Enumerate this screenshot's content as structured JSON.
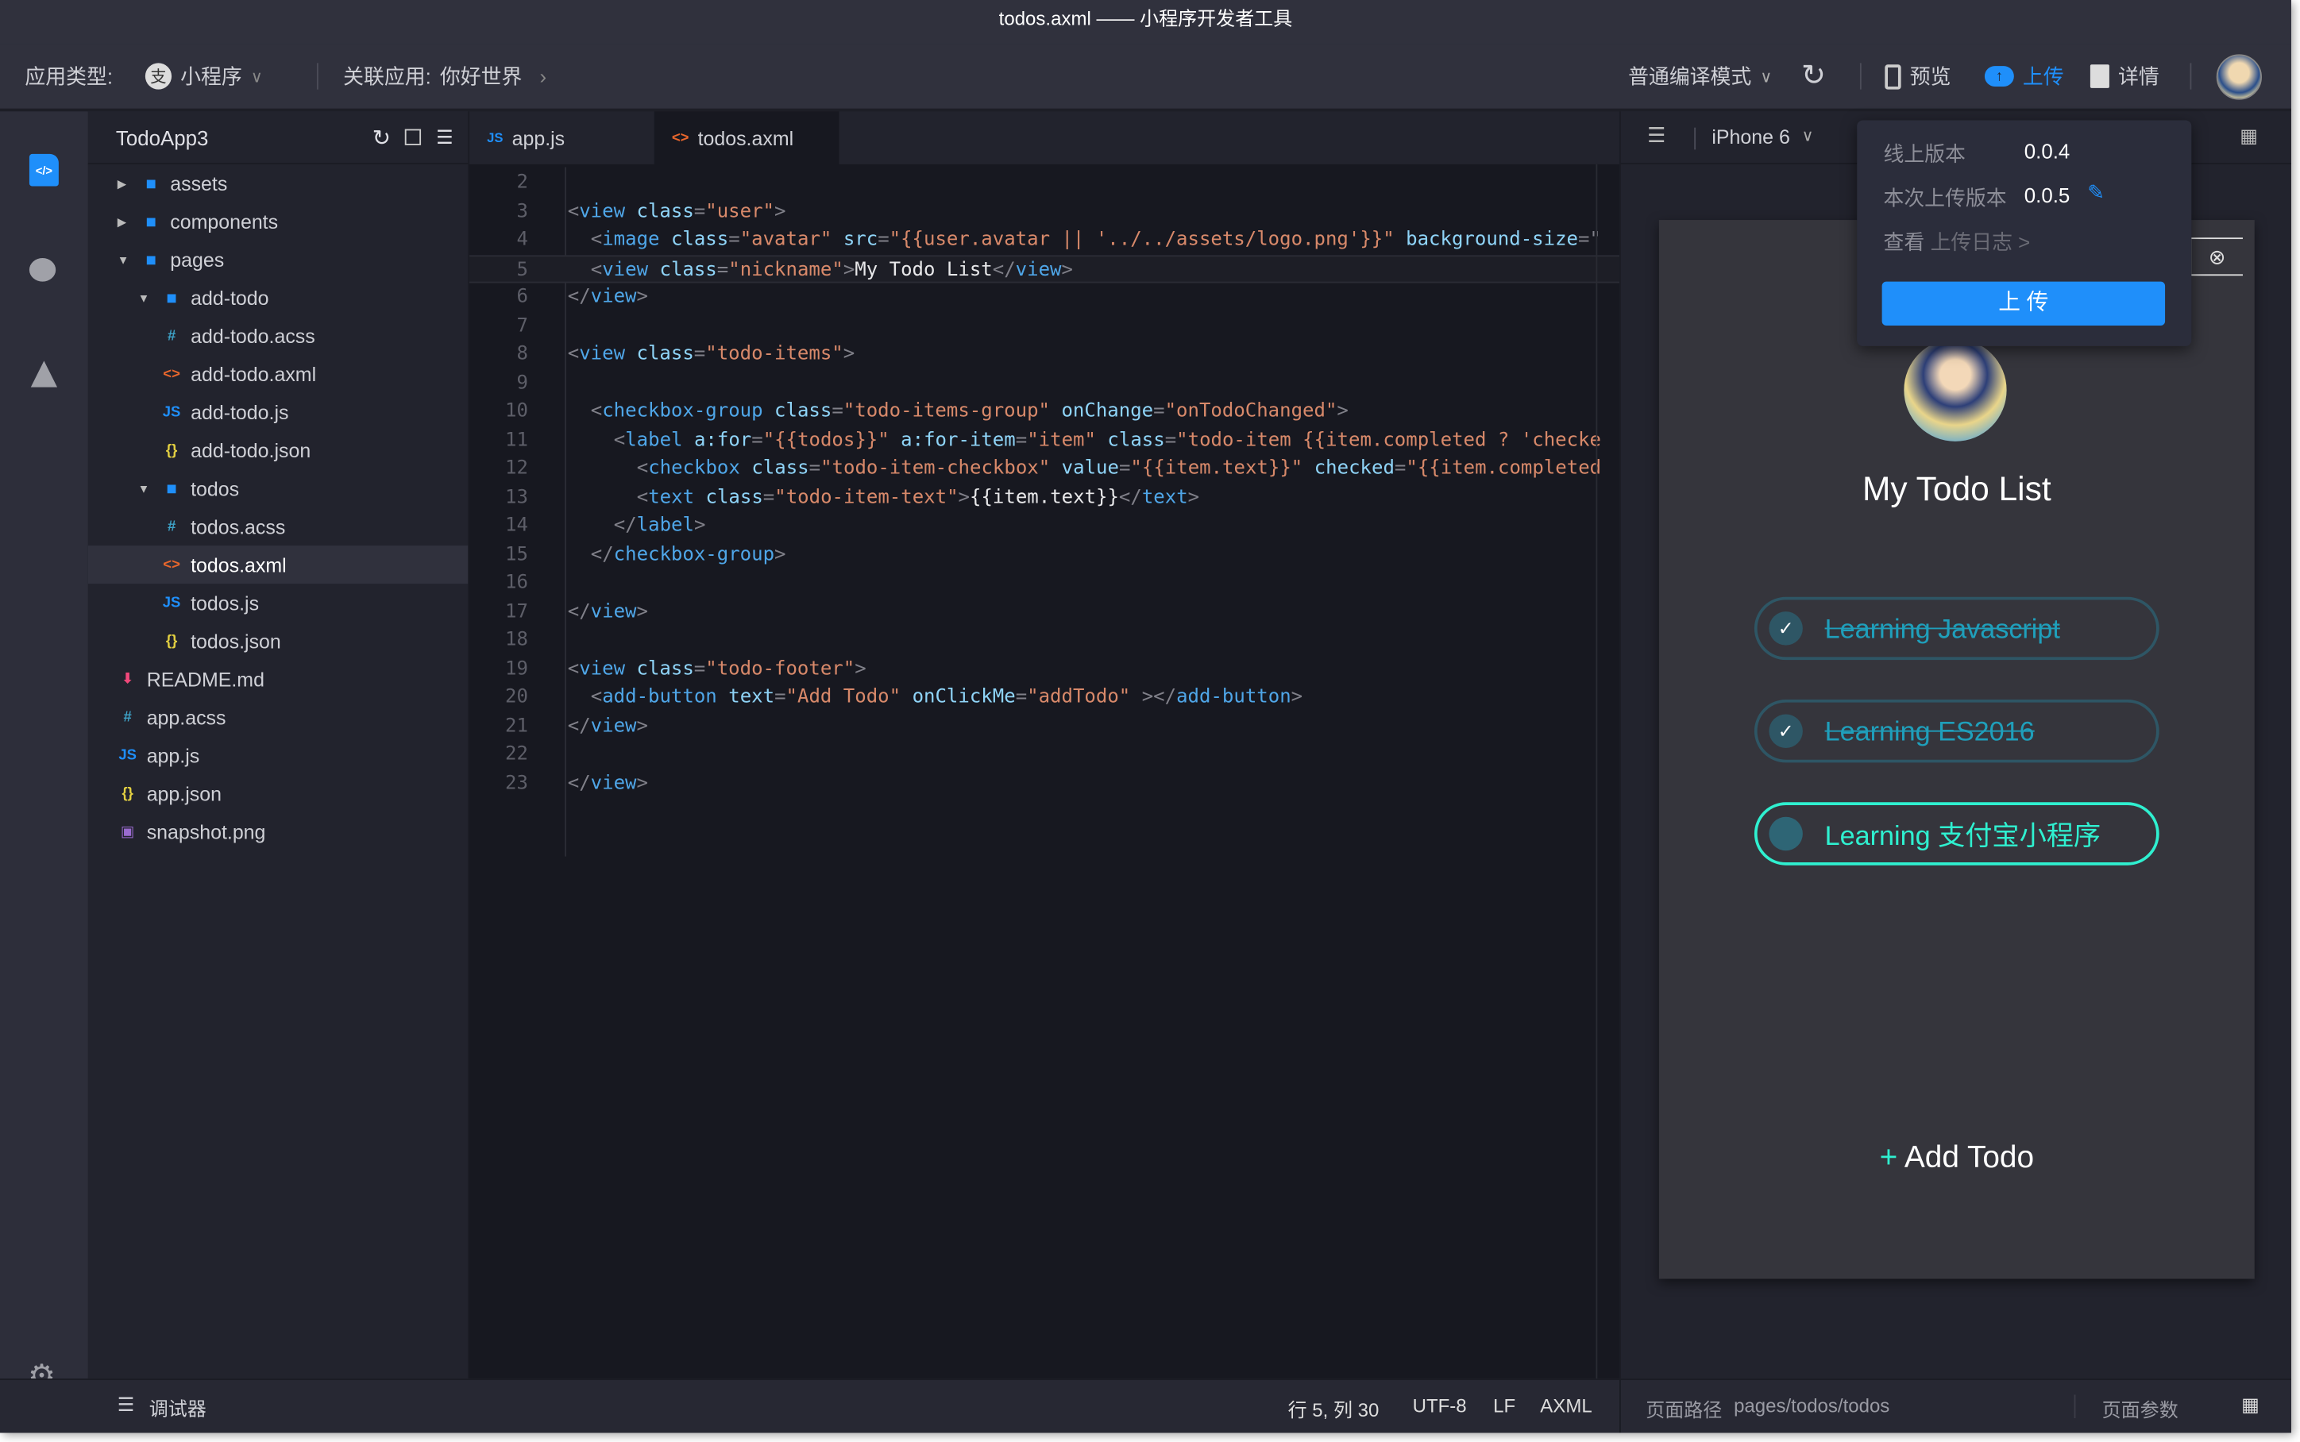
{
  "window": {
    "title": "todos.axml —— 小程序开发者工具"
  },
  "toolbar": {
    "app_type_label": "应用类型:",
    "app_type_value": "小程序",
    "linked_app_label": "关联应用:",
    "linked_app_value": "你好世界",
    "compile_mode": "普通编译模式",
    "preview": "预览",
    "upload": "上传",
    "details": "详情"
  },
  "explorer": {
    "project": "TodoApp3",
    "items": [
      {
        "label": "assets",
        "type": "folder",
        "depth": 0,
        "expanded": false
      },
      {
        "label": "components",
        "type": "folder",
        "depth": 0,
        "expanded": false
      },
      {
        "label": "pages",
        "type": "folder",
        "depth": 0,
        "expanded": true
      },
      {
        "label": "add-todo",
        "type": "folder",
        "depth": 1,
        "expanded": true
      },
      {
        "label": "add-todo.acss",
        "type": "acss",
        "depth": 2
      },
      {
        "label": "add-todo.axml",
        "type": "axml",
        "depth": 2
      },
      {
        "label": "add-todo.js",
        "type": "js",
        "depth": 2
      },
      {
        "label": "add-todo.json",
        "type": "json",
        "depth": 2
      },
      {
        "label": "todos",
        "type": "folder",
        "depth": 1,
        "expanded": true
      },
      {
        "label": "todos.acss",
        "type": "acss",
        "depth": 2
      },
      {
        "label": "todos.axml",
        "type": "axml",
        "depth": 2,
        "selected": true
      },
      {
        "label": "todos.js",
        "type": "js",
        "depth": 2
      },
      {
        "label": "todos.json",
        "type": "json",
        "depth": 2
      },
      {
        "label": "README.md",
        "type": "md",
        "depth": 0
      },
      {
        "label": "app.acss",
        "type": "acss",
        "depth": 0
      },
      {
        "label": "app.js",
        "type": "js",
        "depth": 0
      },
      {
        "label": "app.json",
        "type": "json",
        "depth": 0
      },
      {
        "label": "snapshot.png",
        "type": "png",
        "depth": 0
      }
    ]
  },
  "tabs": [
    {
      "label": "app.js",
      "type": "js"
    },
    {
      "label": "todos.axml",
      "type": "axml",
      "active": true
    }
  ],
  "code": {
    "current_line": 5,
    "lines": [
      {
        "n": "2",
        "indent": 0,
        "tokens": []
      },
      {
        "n": "3",
        "indent": 1,
        "tokens": [
          [
            "p",
            "<"
          ],
          [
            "tag",
            "view"
          ],
          [
            "t",
            " "
          ],
          [
            "attr",
            "class"
          ],
          [
            "p",
            "="
          ],
          [
            "str",
            "\"user\""
          ],
          [
            "p",
            ">"
          ]
        ]
      },
      {
        "n": "4",
        "indent": 2,
        "tokens": [
          [
            "p",
            "<"
          ],
          [
            "tag",
            "image"
          ],
          [
            "t",
            " "
          ],
          [
            "attr",
            "class"
          ],
          [
            "p",
            "="
          ],
          [
            "str",
            "\"avatar\""
          ],
          [
            "t",
            " "
          ],
          [
            "attr",
            "src"
          ],
          [
            "p",
            "="
          ],
          [
            "str",
            "\"{{user.avatar || '../../assets/logo.png'}}\""
          ],
          [
            "t",
            " "
          ],
          [
            "attr",
            "background-size"
          ],
          [
            "p",
            "=\""
          ]
        ]
      },
      {
        "n": "5",
        "indent": 2,
        "tokens": [
          [
            "p",
            "<"
          ],
          [
            "tag",
            "view"
          ],
          [
            "t",
            " "
          ],
          [
            "attr",
            "class"
          ],
          [
            "p",
            "="
          ],
          [
            "str",
            "\"nickname\""
          ],
          [
            "p",
            ">"
          ],
          [
            "txt",
            "My Todo List"
          ],
          [
            "p",
            "</"
          ],
          [
            "tag",
            "view"
          ],
          [
            "p",
            ">"
          ]
        ]
      },
      {
        "n": "6",
        "indent": 1,
        "tokens": [
          [
            "p",
            "</"
          ],
          [
            "tag",
            "view"
          ],
          [
            "p",
            ">"
          ]
        ]
      },
      {
        "n": "7",
        "indent": 0,
        "tokens": []
      },
      {
        "n": "8",
        "indent": 1,
        "tokens": [
          [
            "p",
            "<"
          ],
          [
            "tag",
            "view"
          ],
          [
            "t",
            " "
          ],
          [
            "attr",
            "class"
          ],
          [
            "p",
            "="
          ],
          [
            "str",
            "\"todo-items\""
          ],
          [
            "p",
            ">"
          ]
        ]
      },
      {
        "n": "9",
        "indent": 0,
        "tokens": []
      },
      {
        "n": "10",
        "indent": 2,
        "tokens": [
          [
            "p",
            "<"
          ],
          [
            "tag",
            "checkbox-group"
          ],
          [
            "t",
            " "
          ],
          [
            "attr",
            "class"
          ],
          [
            "p",
            "="
          ],
          [
            "str",
            "\"todo-items-group\""
          ],
          [
            "t",
            " "
          ],
          [
            "attr",
            "onChange"
          ],
          [
            "p",
            "="
          ],
          [
            "str",
            "\"onTodoChanged\""
          ],
          [
            "p",
            ">"
          ]
        ]
      },
      {
        "n": "11",
        "indent": 3,
        "tokens": [
          [
            "p",
            "<"
          ],
          [
            "tag",
            "label"
          ],
          [
            "t",
            " "
          ],
          [
            "attr",
            "a:for"
          ],
          [
            "p",
            "="
          ],
          [
            "str",
            "\"{{todos}}\""
          ],
          [
            "t",
            " "
          ],
          [
            "attr",
            "a:for-item"
          ],
          [
            "p",
            "="
          ],
          [
            "str",
            "\"item\""
          ],
          [
            "t",
            " "
          ],
          [
            "attr",
            "class"
          ],
          [
            "p",
            "="
          ],
          [
            "str",
            "\"todo-item {{item.completed ? 'checke"
          ]
        ]
      },
      {
        "n": "12",
        "indent": 4,
        "tokens": [
          [
            "p",
            "<"
          ],
          [
            "tag",
            "checkbox"
          ],
          [
            "t",
            " "
          ],
          [
            "attr",
            "class"
          ],
          [
            "p",
            "="
          ],
          [
            "str",
            "\"todo-item-checkbox\""
          ],
          [
            "t",
            " "
          ],
          [
            "attr",
            "value"
          ],
          [
            "p",
            "="
          ],
          [
            "str",
            "\"{{item.text}}\""
          ],
          [
            "t",
            " "
          ],
          [
            "attr",
            "checked"
          ],
          [
            "p",
            "="
          ],
          [
            "str",
            "\"{{item.completed"
          ]
        ]
      },
      {
        "n": "13",
        "indent": 4,
        "tokens": [
          [
            "p",
            "<"
          ],
          [
            "tag",
            "text"
          ],
          [
            "t",
            " "
          ],
          [
            "attr",
            "class"
          ],
          [
            "p",
            "="
          ],
          [
            "str",
            "\"todo-item-text\""
          ],
          [
            "p",
            ">"
          ],
          [
            "txt",
            "{{item.text}}"
          ],
          [
            "p",
            "</"
          ],
          [
            "tag",
            "text"
          ],
          [
            "p",
            ">"
          ]
        ]
      },
      {
        "n": "14",
        "indent": 3,
        "tokens": [
          [
            "p",
            "</"
          ],
          [
            "tag",
            "label"
          ],
          [
            "p",
            ">"
          ]
        ]
      },
      {
        "n": "15",
        "indent": 2,
        "tokens": [
          [
            "p",
            "</"
          ],
          [
            "tag",
            "checkbox-group"
          ],
          [
            "p",
            ">"
          ]
        ]
      },
      {
        "n": "16",
        "indent": 0,
        "tokens": []
      },
      {
        "n": "17",
        "indent": 1,
        "tokens": [
          [
            "p",
            "</"
          ],
          [
            "tag",
            "view"
          ],
          [
            "p",
            ">"
          ]
        ]
      },
      {
        "n": "18",
        "indent": 0,
        "tokens": []
      },
      {
        "n": "19",
        "indent": 1,
        "tokens": [
          [
            "p",
            "<"
          ],
          [
            "tag",
            "view"
          ],
          [
            "t",
            " "
          ],
          [
            "attr",
            "class"
          ],
          [
            "p",
            "="
          ],
          [
            "str",
            "\"todo-footer\""
          ],
          [
            "p",
            ">"
          ]
        ]
      },
      {
        "n": "20",
        "indent": 2,
        "tokens": [
          [
            "p",
            "<"
          ],
          [
            "tag",
            "add-button"
          ],
          [
            "t",
            " "
          ],
          [
            "attr",
            "text"
          ],
          [
            "p",
            "="
          ],
          [
            "str",
            "\"Add Todo\""
          ],
          [
            "t",
            " "
          ],
          [
            "attr",
            "onClickMe"
          ],
          [
            "p",
            "="
          ],
          [
            "str",
            "\"addTodo\""
          ],
          [
            "t",
            " "
          ],
          [
            "p",
            "></"
          ],
          [
            "tag",
            "add-button"
          ],
          [
            "p",
            ">"
          ]
        ]
      },
      {
        "n": "21",
        "indent": 1,
        "tokens": [
          [
            "p",
            "</"
          ],
          [
            "tag",
            "view"
          ],
          [
            "p",
            ">"
          ]
        ]
      },
      {
        "n": "22",
        "indent": 0,
        "tokens": []
      },
      {
        "n": "23",
        "indent": 0,
        "tokens": [
          [
            "p",
            "</"
          ],
          [
            "tag",
            "view"
          ],
          [
            "p",
            ">"
          ]
        ]
      }
    ]
  },
  "preview": {
    "device": "iPhone 6",
    "nickname": "My Todo List",
    "todos": [
      {
        "text": "Learning Javascript",
        "completed": true
      },
      {
        "text": "Learning ES2016",
        "completed": true
      },
      {
        "text": "Learning 支付宝小程序",
        "completed": false
      }
    ],
    "add_button": "Add Todo"
  },
  "upload_popup": {
    "online_label": "线上版本",
    "online_version": "0.0.4",
    "this_label": "本次上传版本",
    "this_version": "0.0.5",
    "log_prefix": "查看",
    "log_link": "上传日志 >",
    "button": "上 传"
  },
  "status": {
    "debugger": "调试器",
    "position": "行 5, 列 30",
    "encoding": "UTF-8",
    "eol": "LF",
    "language": "AXML",
    "page_path_label": "页面路径",
    "page_path": "pages/todos/todos",
    "page_params": "页面参数"
  },
  "colors": {
    "accent": "#1f8ffa",
    "todo_active": "#2ff0d0",
    "todo_done": "#1f9fbb"
  }
}
